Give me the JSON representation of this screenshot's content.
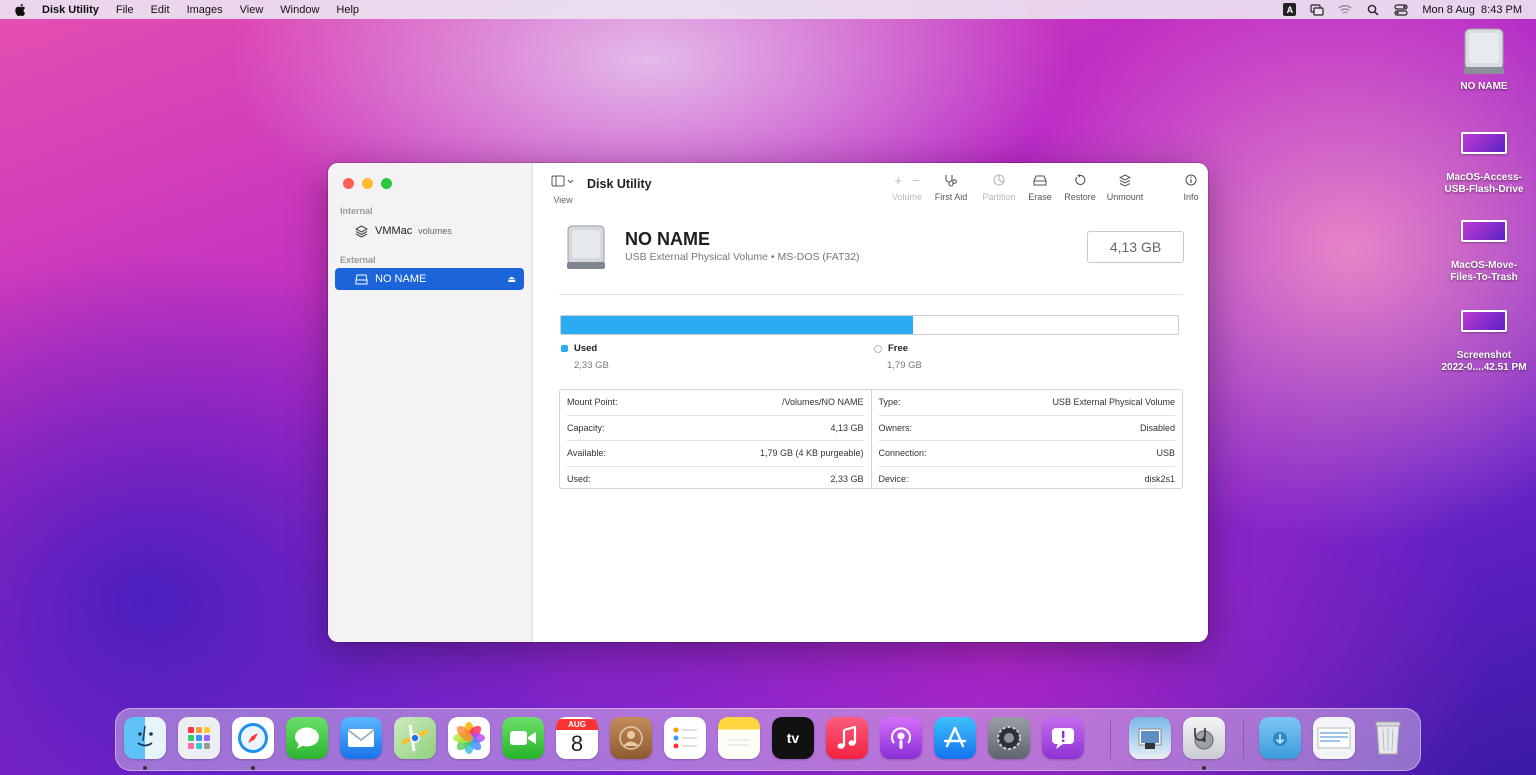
{
  "menubar": {
    "app_name": "Disk Utility",
    "items": [
      "File",
      "Edit",
      "Images",
      "View",
      "Window",
      "Help"
    ],
    "datetime": "Mon 8 Aug  8:43 PM",
    "input_badge": "A"
  },
  "desktop": {
    "items": [
      {
        "label": "NO NAME",
        "icon": "external-drive-icon"
      },
      {
        "label": "MacOS-Access-\nUSB-Flash-Drive",
        "icon": "screenshot-thumbnail"
      },
      {
        "label": "MacOS-Move-\nFiles-To-Trash",
        "icon": "screenshot-thumbnail"
      },
      {
        "label": "Screenshot\n2022-0....42.51 PM",
        "icon": "screenshot-thumbnail"
      }
    ]
  },
  "window": {
    "title": "Disk Utility",
    "view_label": "View",
    "sidebar": {
      "internal_label": "Internal",
      "external_label": "External",
      "internal_item": {
        "label": "VMMac",
        "sub": "volumes"
      },
      "external_item": {
        "label": "NO NAME",
        "eject": "⏏"
      }
    },
    "toolbar": {
      "volume": "Volume",
      "first_aid": "First Aid",
      "partition": "Partition",
      "erase": "Erase",
      "restore": "Restore",
      "unmount": "Unmount",
      "info": "Info",
      "plus": "+",
      "minus": "−"
    },
    "disk": {
      "name": "NO NAME",
      "description": "USB External Physical Volume • MS-DOS (FAT32)",
      "capacity": "4,13 GB"
    },
    "usage": {
      "used_fraction": 0.57,
      "used_label": "Used",
      "used_value": "2,33 GB",
      "free_label": "Free",
      "free_value": "1,79 GB",
      "used_color": "#2aabf2"
    },
    "info_left": [
      {
        "key": "Mount Point:",
        "value": "/Volumes/NO NAME"
      },
      {
        "key": "Capacity:",
        "value": "4,13 GB"
      },
      {
        "key": "Available:",
        "value": "1,79 GB (4 KB purgeable)"
      },
      {
        "key": "Used:",
        "value": "2,33 GB"
      }
    ],
    "info_right": [
      {
        "key": "Type:",
        "value": "USB External Physical Volume"
      },
      {
        "key": "Owners:",
        "value": "Disabled"
      },
      {
        "key": "Connection:",
        "value": "USB"
      },
      {
        "key": "Device:",
        "value": "disk2s1"
      }
    ]
  },
  "dock": {
    "calendar_month": "AUG",
    "calendar_day": "8",
    "tv_label": "tv",
    "apps": [
      "finder-icon",
      "launchpad-icon",
      "safari-icon",
      "messages-icon",
      "mail-icon",
      "maps-icon",
      "photos-icon",
      "facetime-icon",
      "calendar-icon",
      "contacts-icon",
      "reminders-icon",
      "notes-icon",
      "appletv-icon",
      "music-icon",
      "podcasts-icon",
      "appstore-icon",
      "system-preferences-icon",
      "feedback-assistant-icon",
      "preview-icon",
      "disk-utility-icon",
      "downloads-folder-icon",
      "recent-screenshot-icon",
      "trash-icon"
    ]
  }
}
